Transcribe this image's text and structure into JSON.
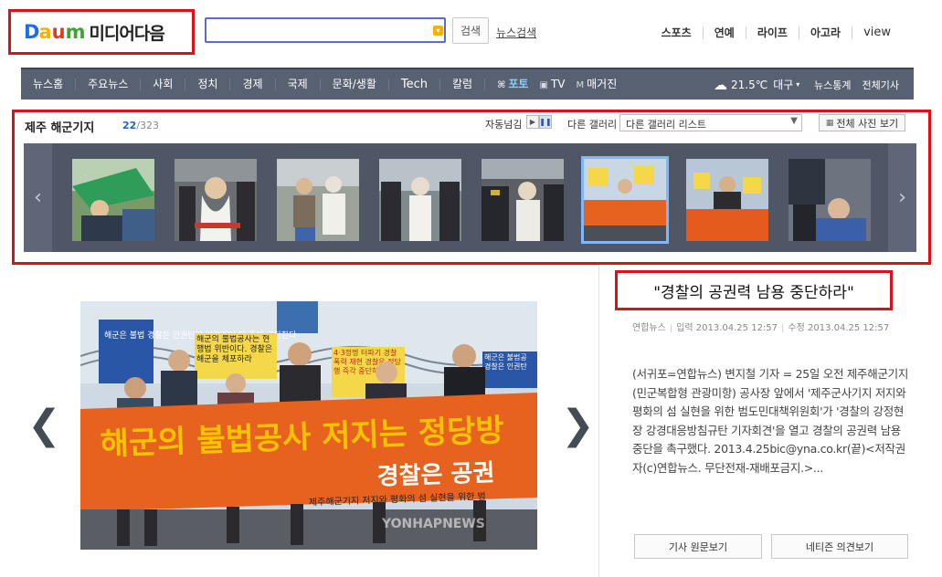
{
  "header": {
    "logo_letters": [
      "D",
      "a",
      "u",
      "m"
    ],
    "logo_sub": "미디어다음",
    "search_value": "",
    "search_button": "검색",
    "news_search_link": "뉴스검색",
    "top_nav": [
      "스포츠",
      "연예",
      "라이프",
      "아고라",
      "view"
    ]
  },
  "gnb": {
    "items": [
      "뉴스홈",
      "주요뉴스",
      "사회",
      "정치",
      "경제",
      "국제",
      "문화/생활",
      "Tech",
      "칼럼"
    ],
    "media_items": [
      {
        "icon": "photo-icon",
        "label": "포토"
      },
      {
        "icon": "tv-icon",
        "label": "TV"
      },
      {
        "icon": "magazine-icon",
        "label": "매거진"
      }
    ],
    "weather": {
      "temp": "21.5℃",
      "city": "대구"
    },
    "right_links": [
      "뉴스통계",
      "전체기사"
    ]
  },
  "gallery": {
    "title": "제주 해군기지",
    "current": "22",
    "total": "/323",
    "autoplay_label": "자동넘김",
    "other_label": "다른 갤러리",
    "select_value": "다른 갤러리 리스트",
    "all_photos_button": "전체 사진 보기",
    "selected_index": 5
  },
  "article": {
    "headline": "\"경찰의 공권력 남용 중단하라\"",
    "source": "연합뉴스",
    "input_time": "입력 2013.04.25 12:57",
    "modified_time": "수정 2013.04.25 12:57",
    "body": "(서귀포=연합뉴스) 변지철 기자 = 25일 오전 제주해군기지(민군복합형 관광미항) 공사장 앞에서 '제주군사기지 저지와 평화의 섬 실현을 위한 범도민대책위원회'가 '경찰의 강정현장 강경대응방침규탄 기자회견'을 열고 경찰의 공권력 남용 중단을 촉구했다. 2013.4.25bic@yna.co.kr(끝)<저작권자(c)연합뉴스. 무단전재-재배포금지.>...",
    "btn_original": "기사 원문보기",
    "btn_comments": "네티즌 의견보기"
  },
  "photo": {
    "banner_main": "해군의 불법공사 저지는 정당방",
    "banner_sub": "경찰은 공권",
    "banner_bottom": "제주해군기지 저지와 평화의 섬 실현을 위한 범",
    "watermark": "YONHAPNEWS",
    "sign_left": "해군은 불법 경찰은 인권탄압 강정주민 다 죽이 규탄한다",
    "sign_center": "해군의 불법공사는 현행법 위반이다. 경찰은 해군을 체포하라",
    "sign_right": "4·3정명 터파기 경찰폭력 재현 경찰은 정당행 즉각 중단하라",
    "sign_far_right": "해군은 불법공 경찰은 인권탄"
  },
  "colors": {
    "accent_red": "#e0101a",
    "gnb_bg": "#586171",
    "photo_blue": "#7fd3ff",
    "banner_orange": "#e8621f",
    "banner_text": "#f6c300"
  }
}
